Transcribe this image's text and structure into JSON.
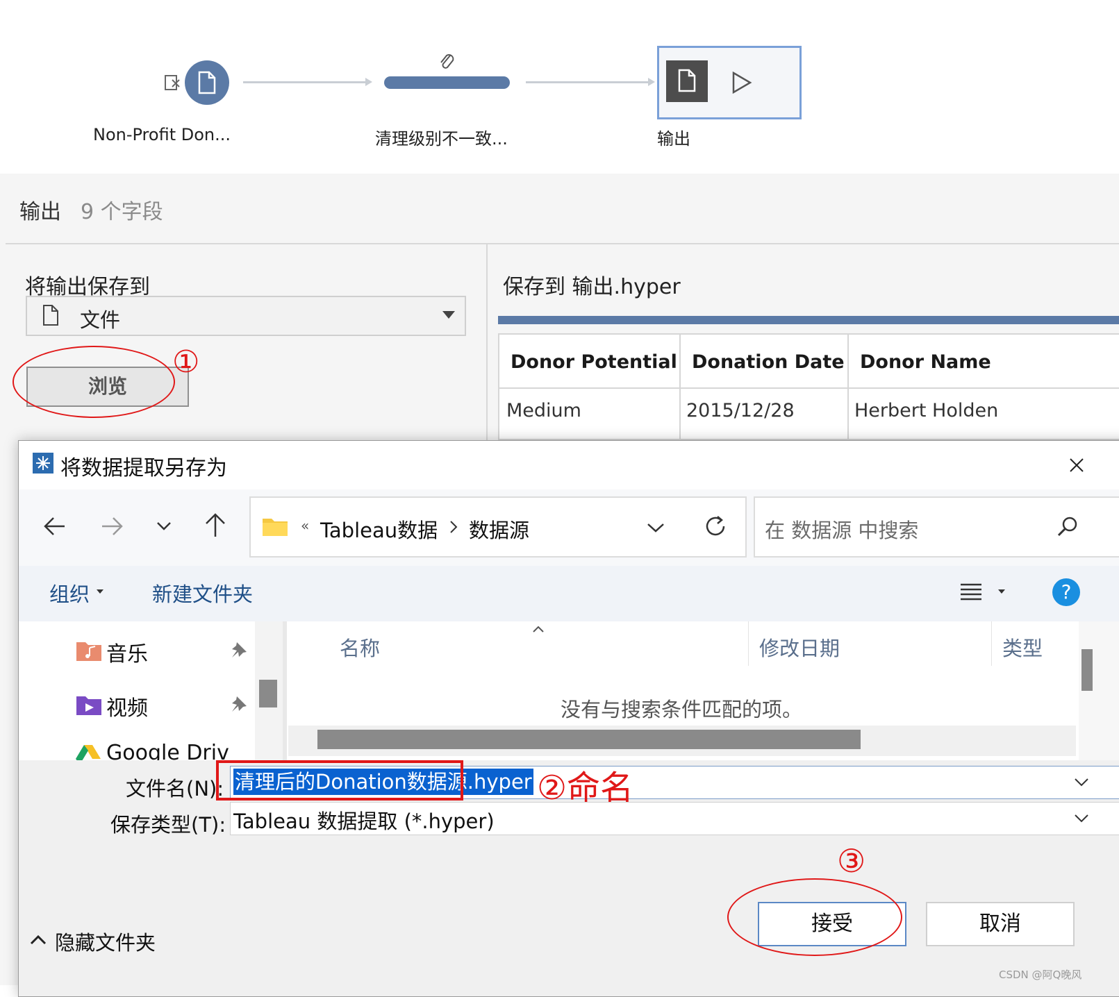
{
  "flow": {
    "nodes": [
      {
        "label": "Non-Profit Don..."
      },
      {
        "label": "清理级别不一致..."
      },
      {
        "label": "输出"
      }
    ]
  },
  "panel": {
    "title": "输出",
    "field_count": "9 个字段",
    "save_to_label": "将输出保存到",
    "save_type_value": "文件",
    "browse_label": "浏览",
    "save_target": "保存到 输出.hyper",
    "preview": {
      "columns": [
        "Donor Potential",
        "Donation Date",
        "Donor Name"
      ],
      "row": [
        "Medium",
        "2015/12/28",
        "Herbert Holden"
      ]
    }
  },
  "dialog": {
    "title": "将数据提取另存为",
    "breadcrumb": [
      "Tableau数据",
      "数据源"
    ],
    "breadcrumb_overflow": "«",
    "search_placeholder": "在 数据源 中搜索",
    "toolbar": {
      "organize": "组织",
      "new_folder": "新建文件夹"
    },
    "nav_items": [
      {
        "label": "音乐"
      },
      {
        "label": "视频"
      },
      {
        "label": "Google Driv"
      }
    ],
    "columns": {
      "name": "名称",
      "date": "修改日期",
      "type": "类型"
    },
    "empty_message": "没有与搜索条件匹配的项。",
    "filename_label": "文件名(N):",
    "filename_value": "清理后的Donation数据源.hyper",
    "filetype_label": "保存类型(T):",
    "filetype_value": "Tableau 数据提取 (*.hyper)",
    "hide_folders": "隐藏文件夹",
    "accept": "接受",
    "cancel": "取消"
  },
  "annotations": {
    "step1": "①",
    "step2": "②命名",
    "step3": "③"
  },
  "watermark": "CSDN @阿Q晚风",
  "colors": {
    "accent": "#5b7aa6",
    "annotation": "#e01818",
    "selection": "#0a62d0"
  }
}
